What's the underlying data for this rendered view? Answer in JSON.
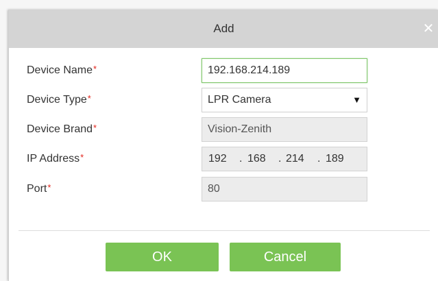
{
  "dialog": {
    "title": "Add",
    "close_icon": "close-icon"
  },
  "form": {
    "device_name": {
      "label": "Device Name",
      "required": "*",
      "value": "192.168.214.189"
    },
    "device_type": {
      "label": "Device Type",
      "required": "*",
      "value": "LPR Camera",
      "arrow": "▼"
    },
    "device_brand": {
      "label": "Device Brand",
      "required": "*",
      "value": "Vision-Zenith"
    },
    "ip_address": {
      "label": "IP Address",
      "required": "*",
      "octets": [
        "192",
        "168",
        "214",
        "189"
      ],
      "separator": "."
    },
    "port": {
      "label": "Port",
      "required": "*",
      "value": "80"
    }
  },
  "buttons": {
    "ok": "OK",
    "cancel": "Cancel"
  },
  "colors": {
    "accent_green": "#7ac354",
    "required_red": "#e2231a",
    "titlebar": "#d4d4d4"
  }
}
